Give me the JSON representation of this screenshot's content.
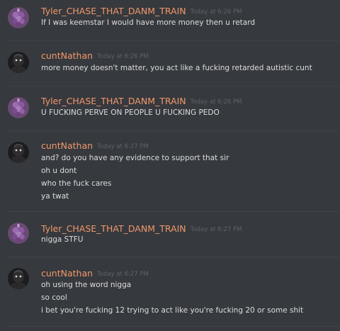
{
  "colors": {
    "background": "#36393e",
    "divider": "#3e4147",
    "username": "#f0986a",
    "timestamp": "#5f6166",
    "message_text": "#dcddde"
  },
  "messages": [
    {
      "author": "Tyler_CHASE_THAT_DANM_TRAIN",
      "timestamp": "Today at 6:26 PM",
      "avatar": "purple-grapes-avatar",
      "lines": [
        "If I was keemstar I would have more money then u retard"
      ]
    },
    {
      "author": "cuntNathan",
      "timestamp": "Today at 6:26 PM",
      "avatar": "dark-character-avatar",
      "lines": [
        "more money doesn't matter, you act like a fucking retarded autistic cunt"
      ]
    },
    {
      "author": "Tyler_CHASE_THAT_DANM_TRAIN",
      "timestamp": "Today at 6:26 PM",
      "avatar": "purple-grapes-avatar",
      "lines": [
        "U FUCKING PERVE ON PEOPLE U FUCKING PEDO"
      ]
    },
    {
      "author": "cuntNathan",
      "timestamp": "Today at 6:27 PM",
      "avatar": "dark-character-avatar",
      "lines": [
        "and? do you have any evidence to support that sir",
        "oh u dont",
        "who the fuck cares",
        "ya twat"
      ]
    },
    {
      "author": "Tyler_CHASE_THAT_DANM_TRAIN",
      "timestamp": "Today at 6:27 PM",
      "avatar": "purple-grapes-avatar",
      "lines": [
        "nigga STFU"
      ]
    },
    {
      "author": "cuntNathan",
      "timestamp": "Today at 6:27 PM",
      "avatar": "dark-character-avatar",
      "lines": [
        "oh using the word nigga",
        "so cool",
        "i bet you're fucking 12 trying to act like you're fucking 20 or some shit"
      ]
    }
  ]
}
